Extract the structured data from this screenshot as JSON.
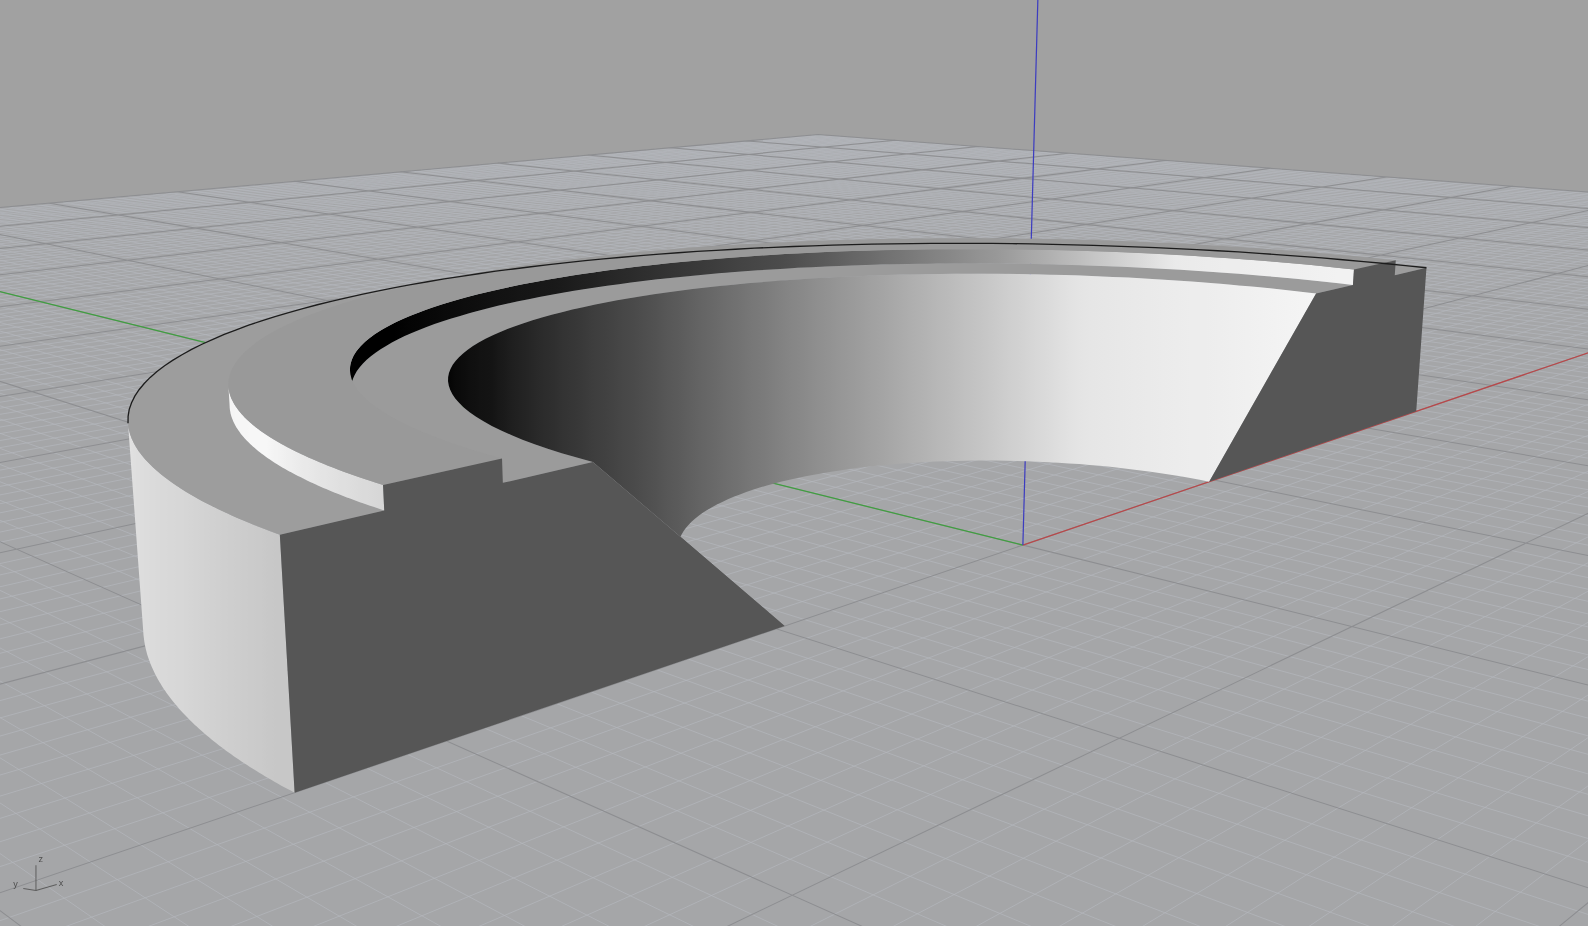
{
  "viewport": {
    "axis_gizmo": {
      "axes": [
        {
          "kind": "up",
          "label": "z"
        },
        {
          "kind": "left",
          "label": "y"
        },
        {
          "kind": "right",
          "label": "x"
        }
      ]
    }
  }
}
